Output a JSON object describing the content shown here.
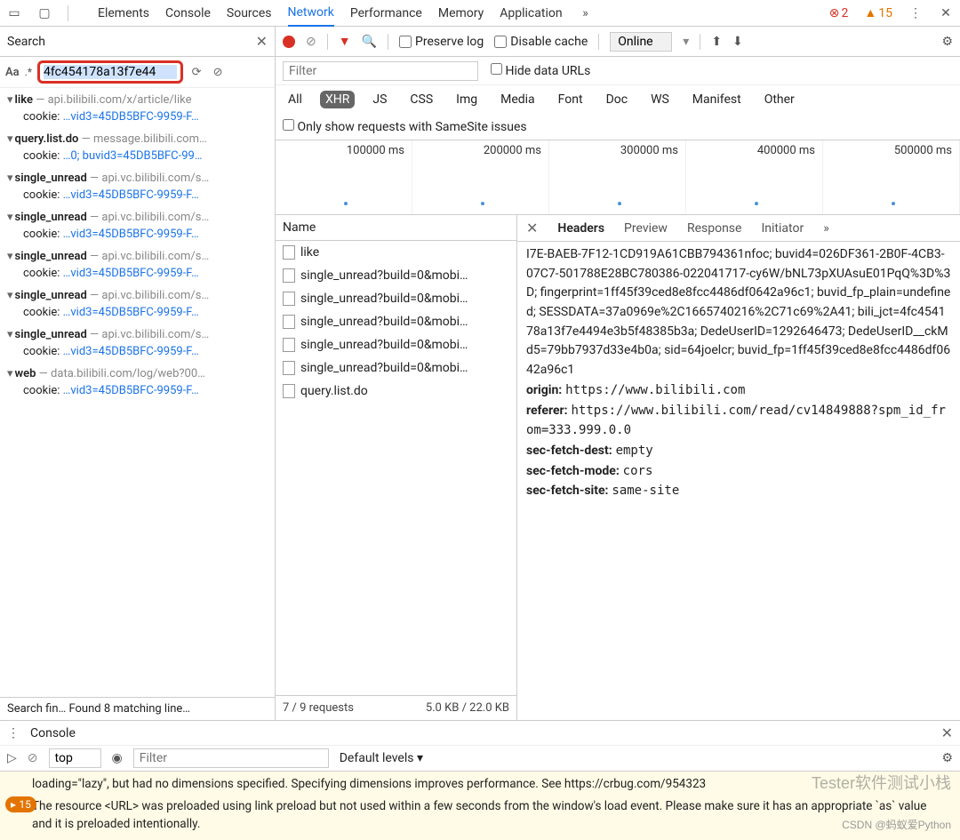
{
  "topbar": {
    "tabs": [
      "Elements",
      "Console",
      "Sources",
      "Network",
      "Performance",
      "Memory",
      "Application"
    ],
    "active": "Network",
    "errors": "2",
    "warnings": "15"
  },
  "search": {
    "title": "Search",
    "aa": "Aa",
    "regex": ".*",
    "value": "4fc454178a13f7e44",
    "footer": "Search fin…   Found 8 matching line…",
    "results": [
      {
        "name": "like",
        "host": " — api.bilibili.com/x/article/like",
        "cookie": "…vid3=45DB5BFC-9959-F…"
      },
      {
        "name": "query.list.do",
        "host": " — message.bilibili.com…",
        "cookie": "…0; buvid3=45DB5BFC-99…"
      },
      {
        "name": "single_unread",
        "host": " — api.vc.bilibili.com/s…",
        "cookie": "…vid3=45DB5BFC-9959-F…"
      },
      {
        "name": "single_unread",
        "host": " — api.vc.bilibili.com/s…",
        "cookie": "…vid3=45DB5BFC-9959-F…"
      },
      {
        "name": "single_unread",
        "host": " — api.vc.bilibili.com/s…",
        "cookie": "…vid3=45DB5BFC-9959-F…"
      },
      {
        "name": "single_unread",
        "host": " — api.vc.bilibili.com/s…",
        "cookie": "…vid3=45DB5BFC-9959-F…"
      },
      {
        "name": "single_unread",
        "host": " — api.vc.bilibili.com/s…",
        "cookie": "…vid3=45DB5BFC-9959-F…"
      },
      {
        "name": "web",
        "host": " — data.bilibili.com/log/web?00…",
        "cookie": "…vid3=45DB5BFC-9959-F…"
      }
    ]
  },
  "net": {
    "preserve": "Preserve log",
    "disable": "Disable cache",
    "online": "Online",
    "filter_ph": "Filter",
    "hide_urls": "Hide data URLs",
    "types": [
      "All",
      "XHR",
      "JS",
      "CSS",
      "Img",
      "Media",
      "Font",
      "Doc",
      "WS",
      "Manifest",
      "Other"
    ],
    "types_active": "XHR",
    "samesite": "Only show requests with SameSite issues",
    "timeline": [
      "100000 ms",
      "200000 ms",
      "300000 ms",
      "400000 ms",
      "500000 ms"
    ],
    "name_header": "Name",
    "requests": [
      "like",
      "single_unread?build=0&mobi…",
      "single_unread?build=0&mobi…",
      "single_unread?build=0&mobi…",
      "single_unread?build=0&mobi…",
      "single_unread?build=0&mobi…",
      "query.list.do"
    ],
    "req_footer_left": "7 / 9 requests",
    "req_footer_right": "5.0 KB / 22.0 KB"
  },
  "detail": {
    "tabs": [
      "Headers",
      "Preview",
      "Response",
      "Initiator"
    ],
    "active": "Headers",
    "cookie": "I7E-BAEB-7F12-1CD919A61CBB794361nfoc; buvid4=026DF361-2B0F-4CB3-07C7-501788E28BC780386-022041717-cy6W/bNL73pXUAsuE01PqQ%3D%3D; fingerprint=1ff45f39ced8e8fcc4486df0642a96c1; buvid_fp_plain=undefined; SESSDATA=37a0969e%2C1665740216%2C71c69%2A41; bili_jct=4fc454178a13f7e4494e3b5f48385b3a; DedeUserID=1292646473; DedeUserID__ckMd5=79bb7937d33e4b0a; sid=64joelcr; buvid_fp=1ff45f39ced8e8fcc4486df0642a96c1",
    "headers": [
      {
        "k": "origin:",
        "v": "https://www.bilibili.com"
      },
      {
        "k": "referer:",
        "v": "https://www.bilibili.com/read/cv14849888?spm_id_from=333.999.0.0"
      },
      {
        "k": "sec-fetch-dest:",
        "v": "empty"
      },
      {
        "k": "sec-fetch-mode:",
        "v": "cors"
      },
      {
        "k": "sec-fetch-site:",
        "v": "same-site"
      }
    ]
  },
  "console": {
    "title": "Console",
    "top": "top",
    "filter_ph": "Filter",
    "levels": "Default levels ▾",
    "msg1": "loading=\"lazy\", but had no dimensions specified. Specifying dimensions improves performance. See https://crbug.com/954323",
    "msg2": "The resource <URL> was preloaded using link preload but not used within a few seconds from the window's load event. Please make sure it has an appropriate `as` value and it is preloaded intentionally.",
    "badge": "15"
  },
  "watermark": "CSDN @蚂蚁爱Python",
  "watermark2": "Tester软件测试小栈"
}
